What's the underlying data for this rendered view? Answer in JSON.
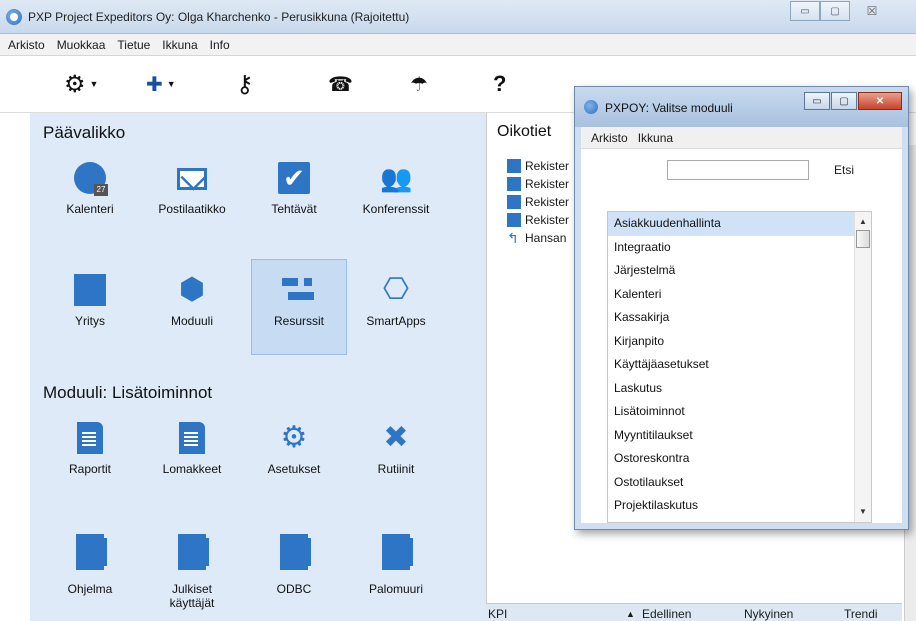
{
  "window": {
    "title": "PXP Project Expeditors Oy: Olga Kharchenko - Perusikkuna (Rajoitettu)",
    "minimize": "▭",
    "maximize": "▢",
    "close": "☒"
  },
  "menu": [
    "Arkisto",
    "Muokkaa",
    "Tietue",
    "Ikkuna",
    "Info"
  ],
  "toolbar": {
    "settings_icon": "⚙",
    "settings_caret": "▼",
    "language_icon": "✚",
    "language_caret": "▼",
    "key_icon": "⚷",
    "phone_icon": "☎",
    "umbrella_icon": "☂",
    "help_icon": "?"
  },
  "main_menu": {
    "title": "Päävalikko",
    "tiles": [
      {
        "label": "Kalenteri",
        "icon": "calendar-icon",
        "badge": "27"
      },
      {
        "label": "Postilaatikko",
        "icon": "mail-icon"
      },
      {
        "label": "Tehtävät",
        "icon": "check-icon",
        "glyph": "✔"
      },
      {
        "label": "Konferenssit",
        "icon": "people-icon",
        "glyph": "👥"
      },
      {
        "label": "Yritys",
        "icon": "book-icon"
      },
      {
        "label": "Moduuli",
        "icon": "hexagons-icon",
        "glyph": "⬢"
      },
      {
        "label": "Resurssit",
        "icon": "resources-icon"
      },
      {
        "label": "SmartApps",
        "icon": "hexagons-outline-icon",
        "glyph": "⎔"
      }
    ]
  },
  "module": {
    "title": "Moduuli:  Lisätoiminnot",
    "tiles": [
      {
        "label": "Raportit",
        "icon": "report-icon"
      },
      {
        "label": "Lomakkeet",
        "icon": "form-icon"
      },
      {
        "label": "Asetukset",
        "icon": "gears-icon",
        "glyph": "⚙"
      },
      {
        "label": "Rutiinit",
        "icon": "tools-icon",
        "glyph": "✖"
      },
      {
        "label": "Ohjelma",
        "icon": "folder-icon"
      },
      {
        "label": "Julkiset käyttäjät",
        "icon": "folder-icon"
      },
      {
        "label": "ODBC",
        "icon": "folder-icon"
      },
      {
        "label": "Palomuuri",
        "icon": "folder-icon"
      }
    ]
  },
  "shortcuts": {
    "title": "Oikotiet",
    "items": [
      "Rekister",
      "Rekister",
      "Rekister",
      "Rekister",
      "Hansan"
    ],
    "arrow": "↰"
  },
  "status_bar": {
    "kpi": "KPI",
    "previous": "Edellinen",
    "previous_arrow": "▲",
    "current": "Nykyinen",
    "trend": "Trendi"
  },
  "dialog": {
    "title": "PXPOY: Valitse moduuli",
    "menu": [
      "Arkisto",
      "Ikkuna"
    ],
    "search_value": "",
    "search_button": "Etsi",
    "modules": [
      "Asiakkuudenhallinta",
      "Integraatio",
      "Järjestelmä",
      "Kalenteri",
      "Kassakirja",
      "Kirjanpito",
      "Käyttäjäasetukset",
      "Laskutus",
      "Lisätoiminnot",
      "Myyntitilaukset",
      "Ostoreskontra",
      "Ostotilaukset",
      "Projektilaskutus"
    ],
    "selected_index": 0,
    "minimize": "▭",
    "maximize": "▢",
    "close": "✕"
  }
}
